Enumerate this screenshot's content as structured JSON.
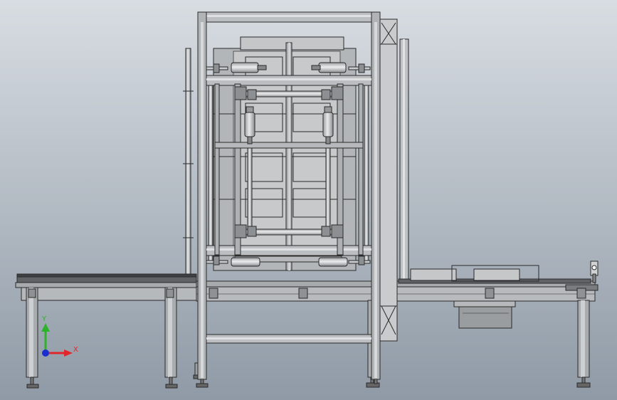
{
  "view": {
    "background_top": "#d8dde2",
    "background_bottom": "#8f9aa6",
    "steel_fill": "#b9bcbe",
    "steel_dark": "#7d8083",
    "edge": "#2a2a2a"
  },
  "triad": {
    "x_label": "X",
    "y_label": "Y",
    "x_color": "#e0262b",
    "y_color": "#2bb32b",
    "z_color": "#1b2fd1"
  }
}
